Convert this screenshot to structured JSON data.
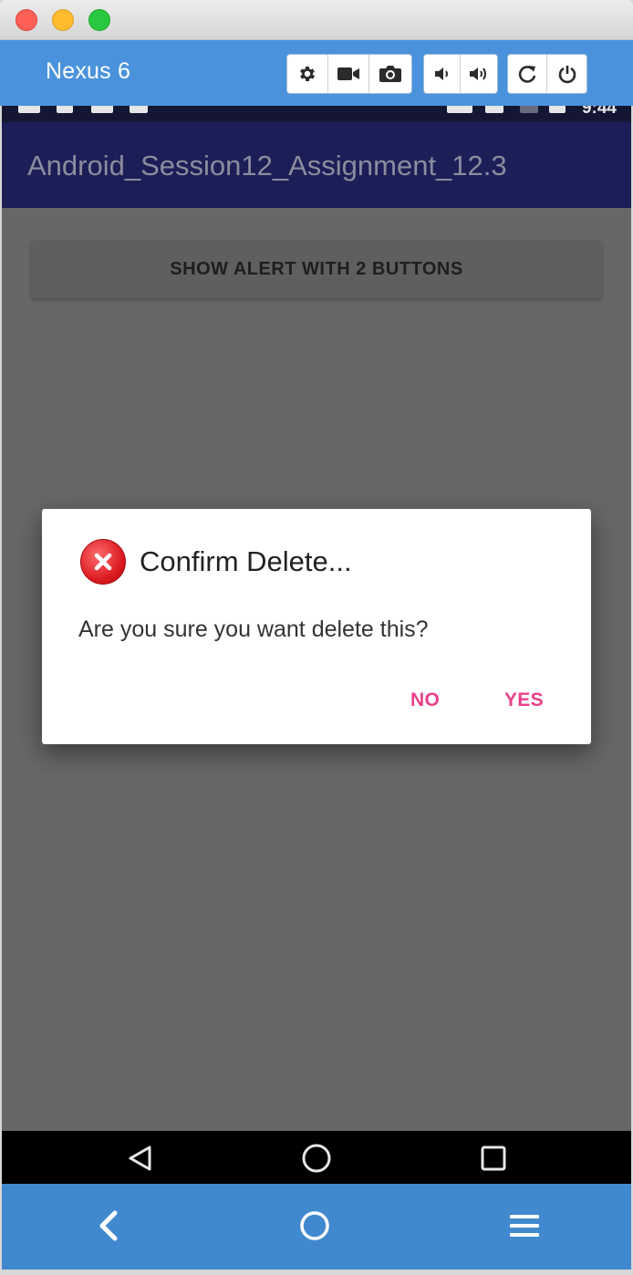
{
  "window": {
    "title": "",
    "traffic_lights": [
      "close",
      "minimize",
      "zoom"
    ]
  },
  "emulator": {
    "device_name": "Nexus 6",
    "toolbar_icons": [
      "gear-icon",
      "video-camera-icon",
      "camera-icon",
      "volume-down-icon",
      "volume-up-icon",
      "rotate-icon",
      "power-icon"
    ],
    "bottom_icons": [
      "chevron-left-icon",
      "circle-home-icon",
      "hamburger-menu-icon"
    ]
  },
  "status_bar": {
    "time": "9:44"
  },
  "app": {
    "title": "Android_Session12_Assignment_12.3",
    "show_alert_button": "SHOW ALERT WITH 2 BUTTONS"
  },
  "dialog": {
    "title": "Confirm Delete...",
    "message": "Are you sure you want delete this?",
    "negative_button": "NO",
    "positive_button": "YES",
    "icon": "error-x-icon"
  },
  "android_nav": {
    "icons": [
      "back-triangle-icon",
      "home-circle-icon",
      "recents-square-icon"
    ]
  },
  "colors": {
    "emulator_blue": "#4a93dc",
    "app_bar": "#1c1f57",
    "dim_overlay": "#676767",
    "dialog_accent": "#e8418a",
    "error_red": "#d9181f"
  }
}
